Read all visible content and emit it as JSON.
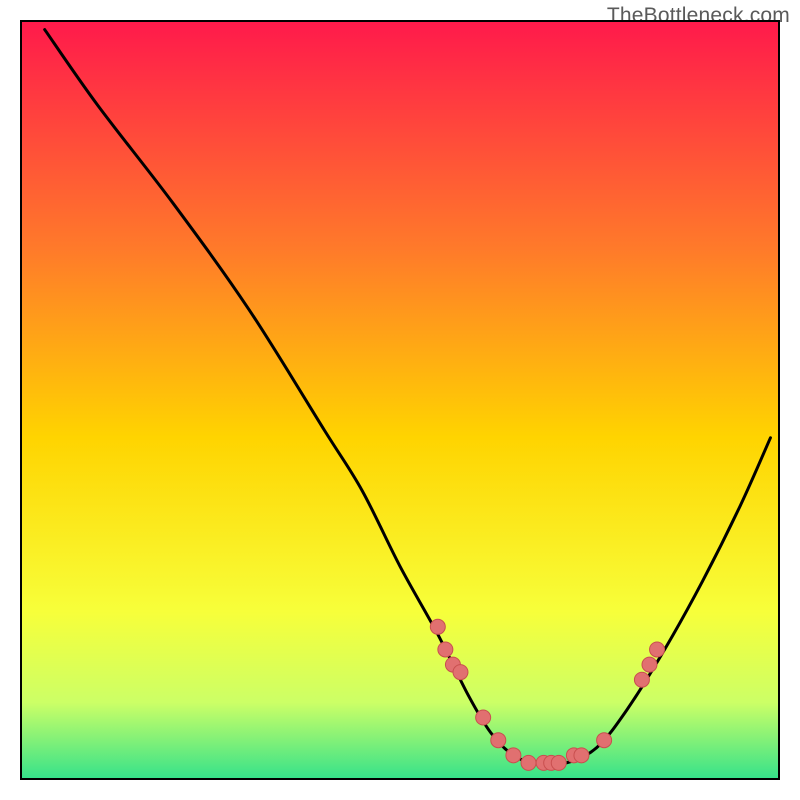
{
  "watermark": "TheBottleneck.com",
  "colors": {
    "gradient_top": "#ff1a4b",
    "gradient_mid_upper": "#ff7a2a",
    "gradient_mid": "#ffd400",
    "gradient_lower": "#f7ff3a",
    "gradient_near_bottom": "#ccff66",
    "gradient_bottom": "#37e28a",
    "curve": "#000000",
    "dot_fill": "#e17070",
    "dot_stroke": "#c94f4f",
    "frame": "#000000"
  },
  "chart_data": {
    "type": "line",
    "title": "",
    "xlabel": "",
    "ylabel": "",
    "xlim": [
      0,
      100
    ],
    "ylim": [
      0,
      100
    ],
    "grid": false,
    "legend": false,
    "series": [
      {
        "name": "bottleneck-curve",
        "x": [
          3,
          10,
          20,
          30,
          40,
          45,
          50,
          55,
          59,
          62,
          65,
          68,
          72,
          76,
          80,
          85,
          90,
          95,
          99
        ],
        "y": [
          99,
          89,
          76,
          62,
          46,
          38,
          28,
          19,
          11,
          6,
          3,
          2,
          2,
          4,
          9,
          17,
          26,
          36,
          45
        ]
      }
    ],
    "scatter_points": {
      "name": "highlight-dots",
      "x": [
        55,
        56,
        57,
        58,
        61,
        63,
        65,
        67,
        69,
        70,
        71,
        73,
        74,
        77,
        82,
        83,
        84
      ],
      "y": [
        20,
        17,
        15,
        14,
        8,
        5,
        3,
        2,
        2,
        2,
        2,
        3,
        3,
        5,
        13,
        15,
        17
      ]
    },
    "background_gradient_stops": [
      {
        "offset": 0.0,
        "color": "#ff1a4b"
      },
      {
        "offset": 0.3,
        "color": "#ff7a2a"
      },
      {
        "offset": 0.55,
        "color": "#ffd400"
      },
      {
        "offset": 0.78,
        "color": "#f7ff3a"
      },
      {
        "offset": 0.9,
        "color": "#ccff66"
      },
      {
        "offset": 1.0,
        "color": "#37e28a"
      }
    ]
  }
}
